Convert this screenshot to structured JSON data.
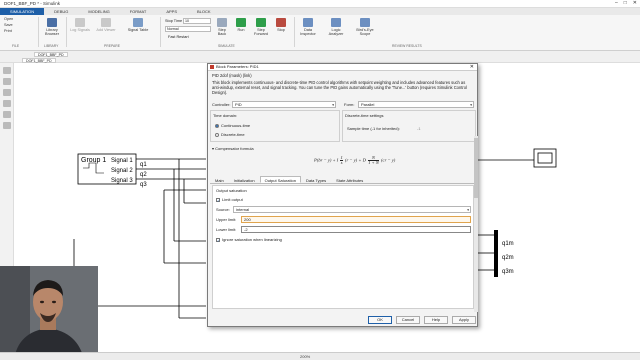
{
  "window": {
    "title": "DOF1_BBF_PD * - Simulink",
    "controls": [
      "–",
      "□",
      "✕"
    ]
  },
  "ribbon_tabs": [
    "SIMULATION",
    "DEBUG",
    "MODELING",
    "FORMAT",
    "APPS",
    "BLOCK"
  ],
  "ribbon": {
    "file": [
      "Open",
      "Save",
      "Print"
    ],
    "library_browser": "Library Browser",
    "log_signals": "Log Signals",
    "add_viewer": "Add Viewer",
    "signal_table": "Signal Table",
    "stop_time_label": "Stop Time",
    "stop_time_value": "10",
    "mode_value": "Normal",
    "fast_restart": "Fast Restart",
    "step_back": "Step Back",
    "run": "Run",
    "step_forward": "Step Forward",
    "stop": "Stop",
    "data_inspector": "Data Inspector",
    "logic_analyzer": "Logic Analyzer",
    "birds_eye": "Bird's-Eye Scope",
    "sections": [
      "FILE",
      "LIBRARY",
      "PREPARE",
      "SIMULATE",
      "REVIEW RESULTS"
    ]
  },
  "model_tab": "DOF1_BBF_PD",
  "breadcrumb": "DOF1_BBF_PD",
  "canvas": {
    "group_title": "Group 1",
    "signals": [
      "Signal 1",
      "Signal 2",
      "Signal 3"
    ],
    "outputs": [
      "q1",
      "q2",
      "q3"
    ],
    "mux_outputs": [
      "q1m",
      "q2m",
      "q3m"
    ]
  },
  "dialog": {
    "title": "Block Parameters: PID1",
    "block_type": "PID 2dof (mask) (link)",
    "description": "This block implements continuous- and discrete-time PID control algorithms with setpoint weighting and includes advanced features such as anti-windup, external reset, and signal tracking. You can tune the PID gains automatically using the 'Tune...' button (requires Simulink Control Design).",
    "controller_label": "Controller:",
    "controller_value": "PID",
    "form_label": "Form:",
    "form_value": "Parallel",
    "time_domain_label": "Time domain:",
    "continuous_time": "Continuous-time",
    "discrete_time": "Discrete-time",
    "discrete_settings_label": "Discrete-time settings",
    "sample_time_label": "Sample time (-1 for inherited):",
    "sample_time_value": "-1",
    "compensator_label": "▾ Compensator formula",
    "formula_main": "P(br − y) + I",
    "formula_num": "1",
    "formula_den": "s",
    "formula_d": "(r − y) + D",
    "formula_nnum": "N",
    "formula_nden": "1 + N",
    "formula_tail": "(cr − y)",
    "subtabs": [
      "Main",
      "Initialization",
      "Output Saturation",
      "Data Types",
      "State Attributes"
    ],
    "active_subtab": "Output Saturation",
    "output_saturation_label": "Output saturation",
    "limit_output_label": "Limit output",
    "source_label": "Source:",
    "source_value": "internal",
    "upper_limit_label": "Upper limit:",
    "upper_limit_value": "200",
    "lower_limit_label": "Lower limit:",
    "lower_limit_value": "-2",
    "ignore_saturation_label": "Ignore saturation when linearizing",
    "buttons": [
      "OK",
      "Cancel",
      "Help",
      "Apply"
    ]
  },
  "status": {
    "zoom": "200%"
  }
}
